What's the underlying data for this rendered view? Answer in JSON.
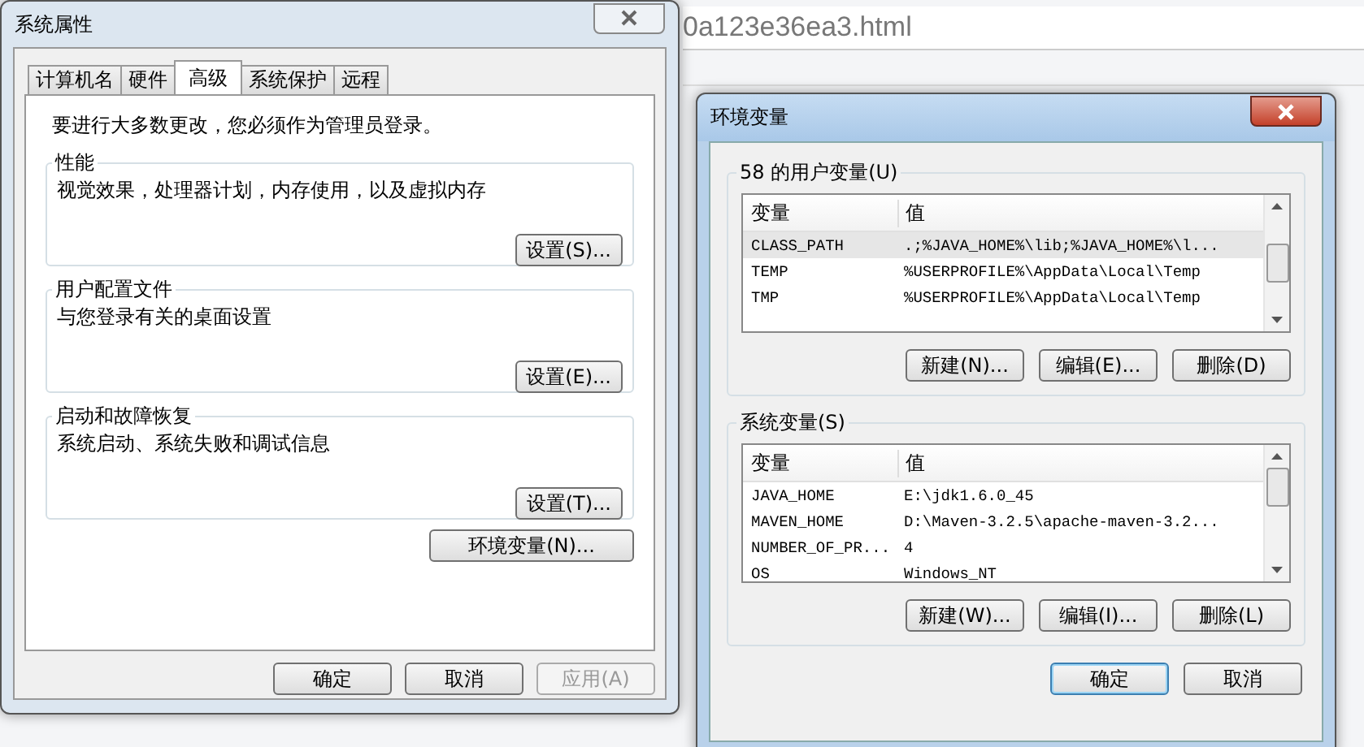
{
  "browser": {
    "address": "0a123e36ea3.html"
  },
  "system_properties": {
    "title": "系统属性",
    "tabs": [
      {
        "label": "计算机名",
        "selected": false
      },
      {
        "label": "硬件",
        "selected": false
      },
      {
        "label": "高级",
        "selected": true
      },
      {
        "label": "系统保护",
        "selected": false
      },
      {
        "label": "远程",
        "selected": false
      }
    ],
    "admin_note": "要进行大多数更改，您必须作为管理员登录。",
    "groups": [
      {
        "title": "性能",
        "description": "视觉效果，处理器计划，内存使用，以及虚拟内存",
        "button": "设置(S)..."
      },
      {
        "title": "用户配置文件",
        "description": "与您登录有关的桌面设置",
        "button": "设置(E)..."
      },
      {
        "title": "启动和故障恢复",
        "description": "系统启动、系统失败和调试信息",
        "button": "设置(T)..."
      }
    ],
    "env_button": "环境变量(N)...",
    "buttons": [
      {
        "label": "确定",
        "disabled": false
      },
      {
        "label": "取消",
        "disabled": false
      },
      {
        "label": "应用(A)",
        "disabled": true
      }
    ]
  },
  "env_vars": {
    "title": "环境变量",
    "lists": [
      {
        "title": "58 的用户变量(U)",
        "columns": [
          "变量",
          "值"
        ],
        "rows": [
          {
            "name": "CLASS_PATH",
            "value": ".;%JAVA_HOME%\\lib;%JAVA_HOME%\\l...",
            "selected": true
          },
          {
            "name": "TEMP",
            "value": "%USERPROFILE%\\AppData\\Local\\Temp",
            "selected": false
          },
          {
            "name": "TMP",
            "value": "%USERPROFILE%\\AppData\\Local\\Temp",
            "selected": false
          }
        ],
        "buttons": [
          "新建(N)...",
          "编辑(E)...",
          "删除(D)"
        ]
      },
      {
        "title": "系统变量(S)",
        "columns": [
          "变量",
          "值"
        ],
        "rows": [
          {
            "name": "JAVA_HOME",
            "value": "E:\\jdk1.6.0_45",
            "selected": false
          },
          {
            "name": "MAVEN_HOME",
            "value": "D:\\Maven-3.2.5\\apache-maven-3.2...",
            "selected": false
          },
          {
            "name": "NUMBER_OF_PR...",
            "value": "4",
            "selected": false
          },
          {
            "name": "OS",
            "value": "Windows_NT",
            "selected": false
          }
        ],
        "buttons": [
          "新建(W)...",
          "编辑(I)...",
          "删除(L)"
        ]
      }
    ],
    "buttons": [
      {
        "label": "确定",
        "default": true
      },
      {
        "label": "取消",
        "default": false
      }
    ]
  }
}
